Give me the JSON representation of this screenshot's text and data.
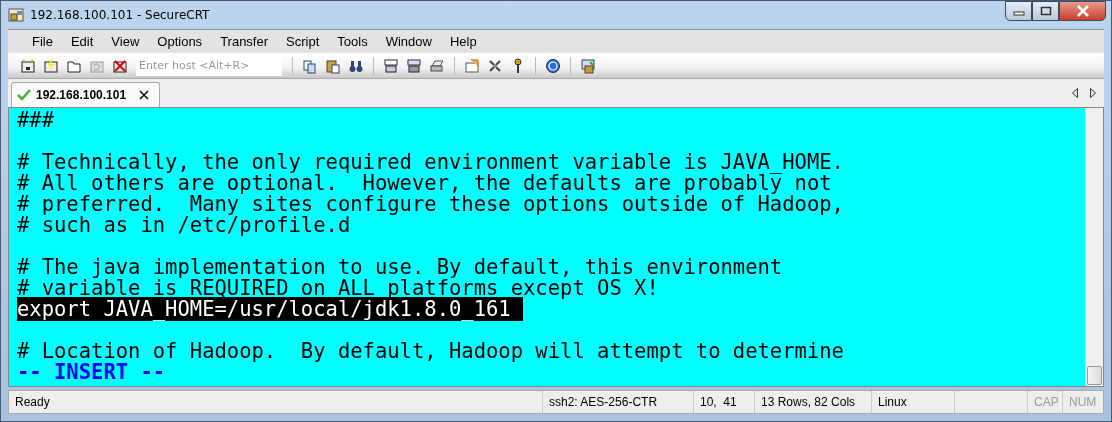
{
  "window": {
    "title": "192.168.100.101 - SecureCRT"
  },
  "menu": [
    "File",
    "Edit",
    "View",
    "Options",
    "Transfer",
    "Script",
    "Tools",
    "Window",
    "Help"
  ],
  "toolbar": {
    "host_field": {
      "placeholder": "Enter host <Alt+R>"
    }
  },
  "tabs": [
    {
      "label": "192.168.100.101",
      "connected": true,
      "selected": true
    }
  ],
  "terminal": {
    "lines": [
      {
        "kind": "text",
        "text": "###"
      },
      {
        "kind": "blank"
      },
      {
        "kind": "text",
        "text": "# Technically, the only required environment variable is JAVA_HOME."
      },
      {
        "kind": "text",
        "text": "# All others are optional.  However, the defaults are probably not"
      },
      {
        "kind": "text",
        "text": "# preferred.  Many sites configure these options outside of Hadoop,"
      },
      {
        "kind": "text",
        "text": "# such as in /etc/profile.d"
      },
      {
        "kind": "blank"
      },
      {
        "kind": "text",
        "text": "# The java implementation to use. By default, this environment"
      },
      {
        "kind": "text",
        "text": "# variable is REQUIRED on ALL platforms except OS X!"
      },
      {
        "kind": "highlight",
        "text": "export JAVA_HOME=/usr/local/jdk1.8.0_161"
      },
      {
        "kind": "blank"
      },
      {
        "kind": "text",
        "text": "# Location of Hadoop.  By default, Hadoop will attempt to determine"
      },
      {
        "kind": "mode",
        "text": "-- INSERT --"
      }
    ]
  },
  "status_bar": [
    {
      "text": "Ready",
      "disabled": false
    },
    {
      "text": "ssh2: AES-256-CTR",
      "disabled": false
    },
    {
      "text": "10,  41",
      "disabled": false
    },
    {
      "text": "13 Rows, 82 Cols",
      "disabled": false
    },
    {
      "text": "Linux",
      "disabled": false
    },
    {
      "text": "CAP",
      "disabled": true
    },
    {
      "text": "NUM",
      "disabled": true
    }
  ]
}
